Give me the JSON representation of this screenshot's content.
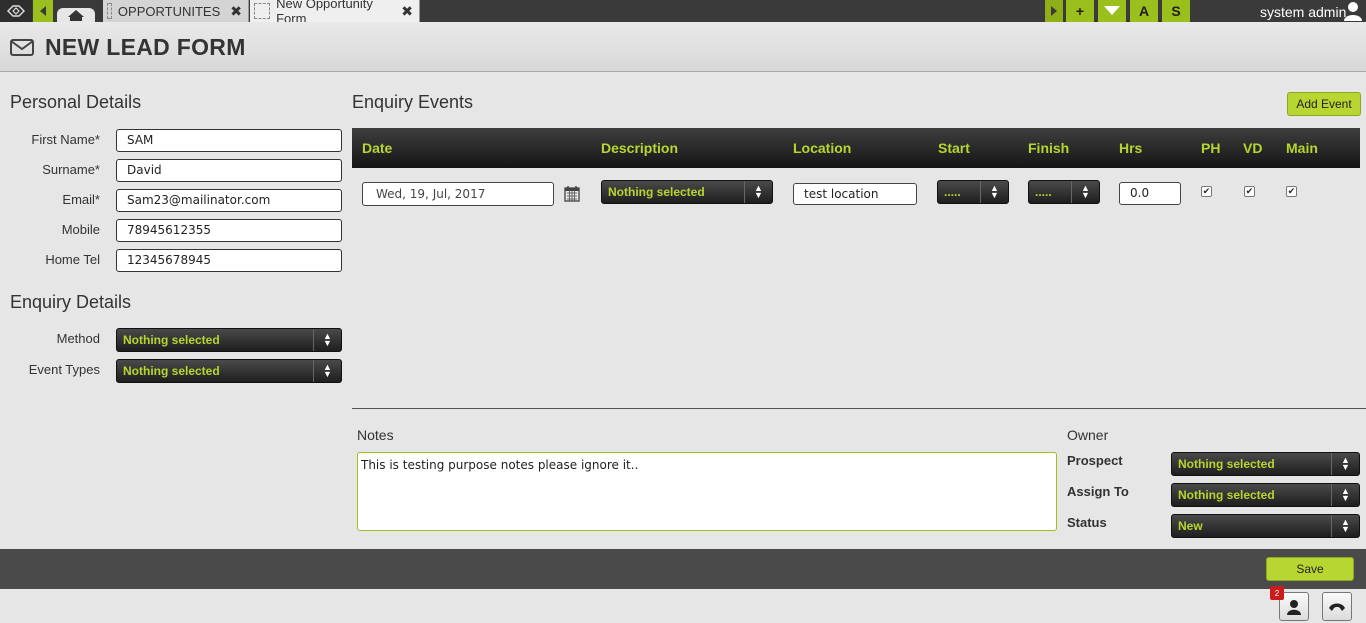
{
  "topbar": {
    "tabs": [
      {
        "label": "OPPORTUNITES"
      },
      {
        "label": "New Opportunity Form"
      }
    ],
    "buttons": {
      "add": "+",
      "a": "A",
      "s": "S"
    },
    "user": "system admin"
  },
  "page": {
    "title": "NEW LEAD FORM"
  },
  "personal": {
    "heading": "Personal Details",
    "fields": [
      {
        "label": "First Name*",
        "value": "SAM"
      },
      {
        "label": "Surname*",
        "value": "David"
      },
      {
        "label": "Email*",
        "value": "Sam23@mailinator.com"
      },
      {
        "label": "Mobile",
        "value": "78945612355"
      },
      {
        "label": "Home Tel",
        "value": "12345678945"
      }
    ]
  },
  "enquiry": {
    "heading": "Enquiry Details",
    "method": {
      "label": "Method",
      "value": "Nothing selected"
    },
    "event_types": {
      "label": "Event Types",
      "value": "Nothing selected"
    }
  },
  "events": {
    "heading": "Enquiry Events",
    "add_button": "Add Event",
    "columns": [
      "Date",
      "Description",
      "Location",
      "Start",
      "Finish",
      "Hrs",
      "PH",
      "VD",
      "Main"
    ],
    "row": {
      "date": "Wed, 19, Jul, 2017",
      "description": "Nothing selected",
      "location": "test location",
      "start": ".....",
      "finish": ".....",
      "hrs": "0.0",
      "ph": "✔",
      "vd": "✔",
      "main": "✔"
    }
  },
  "notes": {
    "label": "Notes",
    "value": "This is testing purpose notes please ignore it.."
  },
  "owner": {
    "heading": "Owner",
    "prospect": {
      "label": "Prospect",
      "value": "Nothing selected"
    },
    "assign_to": {
      "label": "Assign To",
      "value": "Nothing selected"
    },
    "status": {
      "label": "Status",
      "value": "New"
    }
  },
  "footer": {
    "save": "Save",
    "badge": "2"
  },
  "colors": {
    "accent": "#b8d631",
    "dark": "#1e1e1e",
    "select_text": "#b6d62d"
  }
}
